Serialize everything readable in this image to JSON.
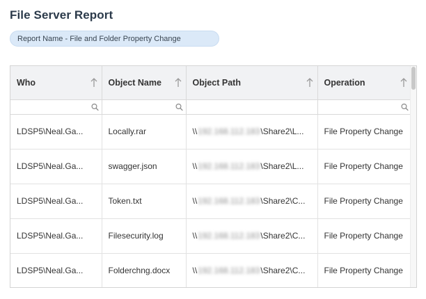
{
  "report": {
    "title": "File Server Report",
    "chip_label": "Report Name - File and Folder Property Change"
  },
  "columns": [
    {
      "label": "Who",
      "sort_icon": "arrow-up-icon",
      "filterable": true
    },
    {
      "label": "Object Name",
      "sort_icon": "arrow-up-icon",
      "filterable": true
    },
    {
      "label": "Object Path",
      "sort_icon": "arrow-up-icon",
      "filterable": false
    },
    {
      "label": "Operation",
      "sort_icon": "arrow-up-icon",
      "filterable": true
    }
  ],
  "filter": {
    "placeholder": ""
  },
  "rows": [
    {
      "who": "LDSP5\\Neal.Ga...",
      "object_name": "Locally.rar",
      "path_prefix": "\\\\",
      "path_hidden": "192.168.112.183",
      "path_suffix": "\\Share2\\L...",
      "operation": "File Property Change"
    },
    {
      "who": "LDSP5\\Neal.Ga...",
      "object_name": "swagger.json",
      "path_prefix": "\\\\",
      "path_hidden": "192.168.112.183",
      "path_suffix": "\\Share2\\L...",
      "operation": "File Property Change"
    },
    {
      "who": "LDSP5\\Neal.Ga...",
      "object_name": "Token.txt",
      "path_prefix": "\\\\",
      "path_hidden": "192.168.112.183",
      "path_suffix": "\\Share2\\C...",
      "operation": "File Property Change"
    },
    {
      "who": "LDSP5\\Neal.Ga...",
      "object_name": "Filesecurity.log",
      "path_prefix": "\\\\",
      "path_hidden": "192.168.112.183",
      "path_suffix": "\\Share2\\C...",
      "operation": "File Property Change"
    },
    {
      "who": "LDSP5\\Neal.Ga...",
      "object_name": "Folderchng.docx",
      "path_prefix": "\\\\",
      "path_hidden": "192.168.112.183",
      "path_suffix": "\\Share2\\C...",
      "operation": "File Property Change"
    }
  ],
  "colors": {
    "chip_bg": "#dbe9f8",
    "header_bg": "#f1f2f4",
    "title": "#2b3a4a"
  }
}
